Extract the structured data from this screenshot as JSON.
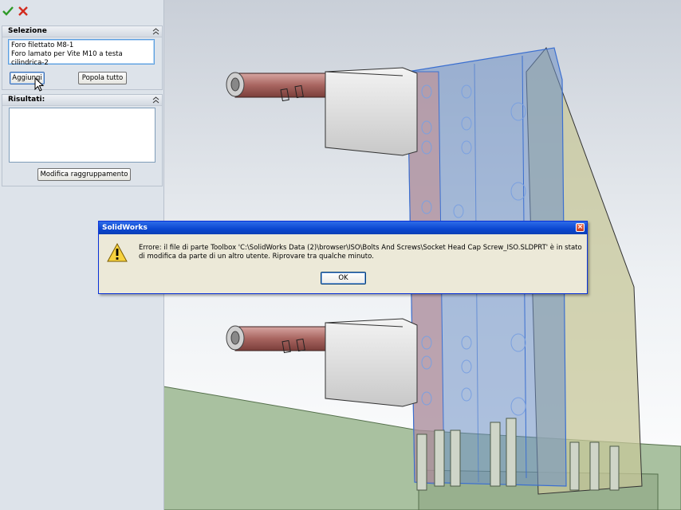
{
  "panel": {
    "toolbar": {
      "ok_icon": "check-icon",
      "cancel_icon": "x-icon",
      "ok_color": "#2e9a27",
      "cancel_color": "#d22b1e"
    },
    "selection": {
      "title": "Selezione",
      "items": [
        "Foro filettato M8-1",
        "Foro lamato per Vite M10 a testa cilindrica-2"
      ],
      "add_label": "Aggiungi",
      "populate_label": "Popola tutto"
    },
    "results": {
      "title": "Risultati:",
      "items": [],
      "modify_label": "Modifica raggruppamento"
    }
  },
  "dialog": {
    "title": "SolidWorks",
    "close_glyph": "×",
    "icon": "warning-icon",
    "message": "Errore:  il file di parte Toolbox 'C:\\SolidWorks Data (2)\\browser\\ISO\\Bolts And Screws\\Socket Head Cap Screw_ISO.SLDPRT' è in stato di modifica da parte di un altro utente.  Riprovare tra qualche minuto.",
    "ok_label": "OK"
  },
  "colors": {
    "title_bar": "#0a46d0",
    "dialog_bg": "#ece9d8",
    "panel_bg": "#dde3ea",
    "highlight": "#4a90e2"
  }
}
